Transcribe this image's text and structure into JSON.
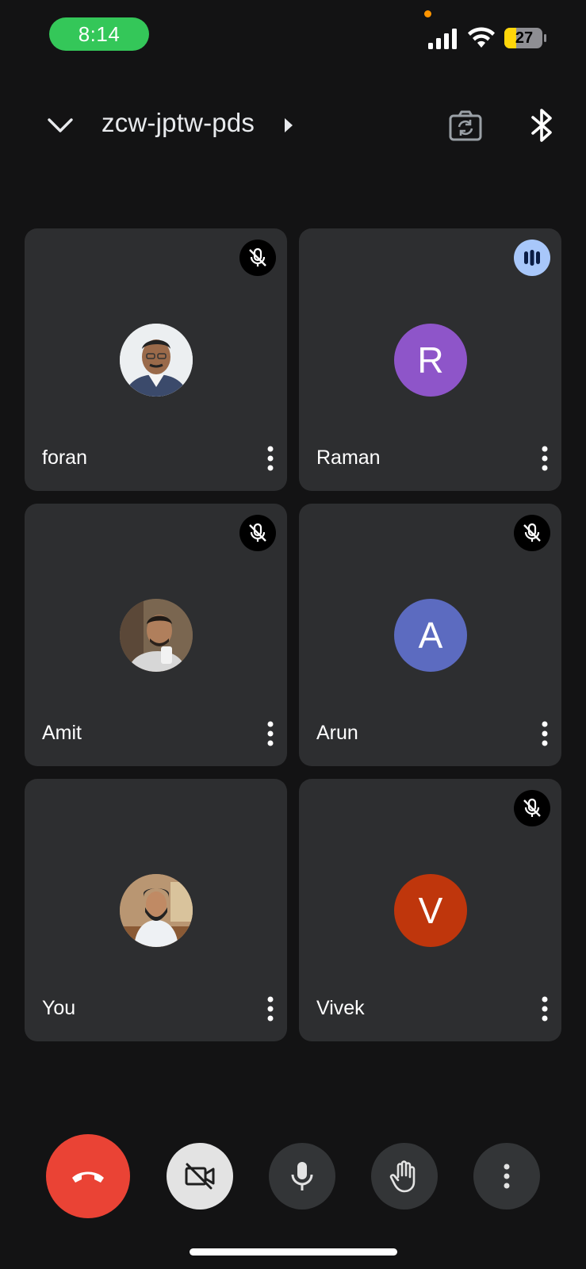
{
  "status_bar": {
    "time": "8:14",
    "battery": "27"
  },
  "header": {
    "meeting_code": "zcw-jptw-pds"
  },
  "participants": [
    {
      "name": "foran",
      "avatar": "photo",
      "mic_muted": true
    },
    {
      "name": "Raman",
      "avatar": "R",
      "avatar_color": "#8e55c9",
      "mic_muted": false,
      "speaking": true
    },
    {
      "name": "Amit",
      "avatar": "photo",
      "mic_muted": true
    },
    {
      "name": "Arun",
      "avatar": "A",
      "avatar_color": "#5c6bc0",
      "mic_muted": true
    },
    {
      "name": "You",
      "avatar": "photo",
      "mic_muted": false
    },
    {
      "name": "Vivek",
      "avatar": "V",
      "avatar_color": "#bf360c",
      "mic_muted": true
    }
  ],
  "controls": {
    "end_call": "end-call-icon",
    "camera": "camera-off-icon",
    "microphone": "microphone-icon",
    "raise_hand": "hand-icon",
    "more": "more-vertical-icon"
  }
}
